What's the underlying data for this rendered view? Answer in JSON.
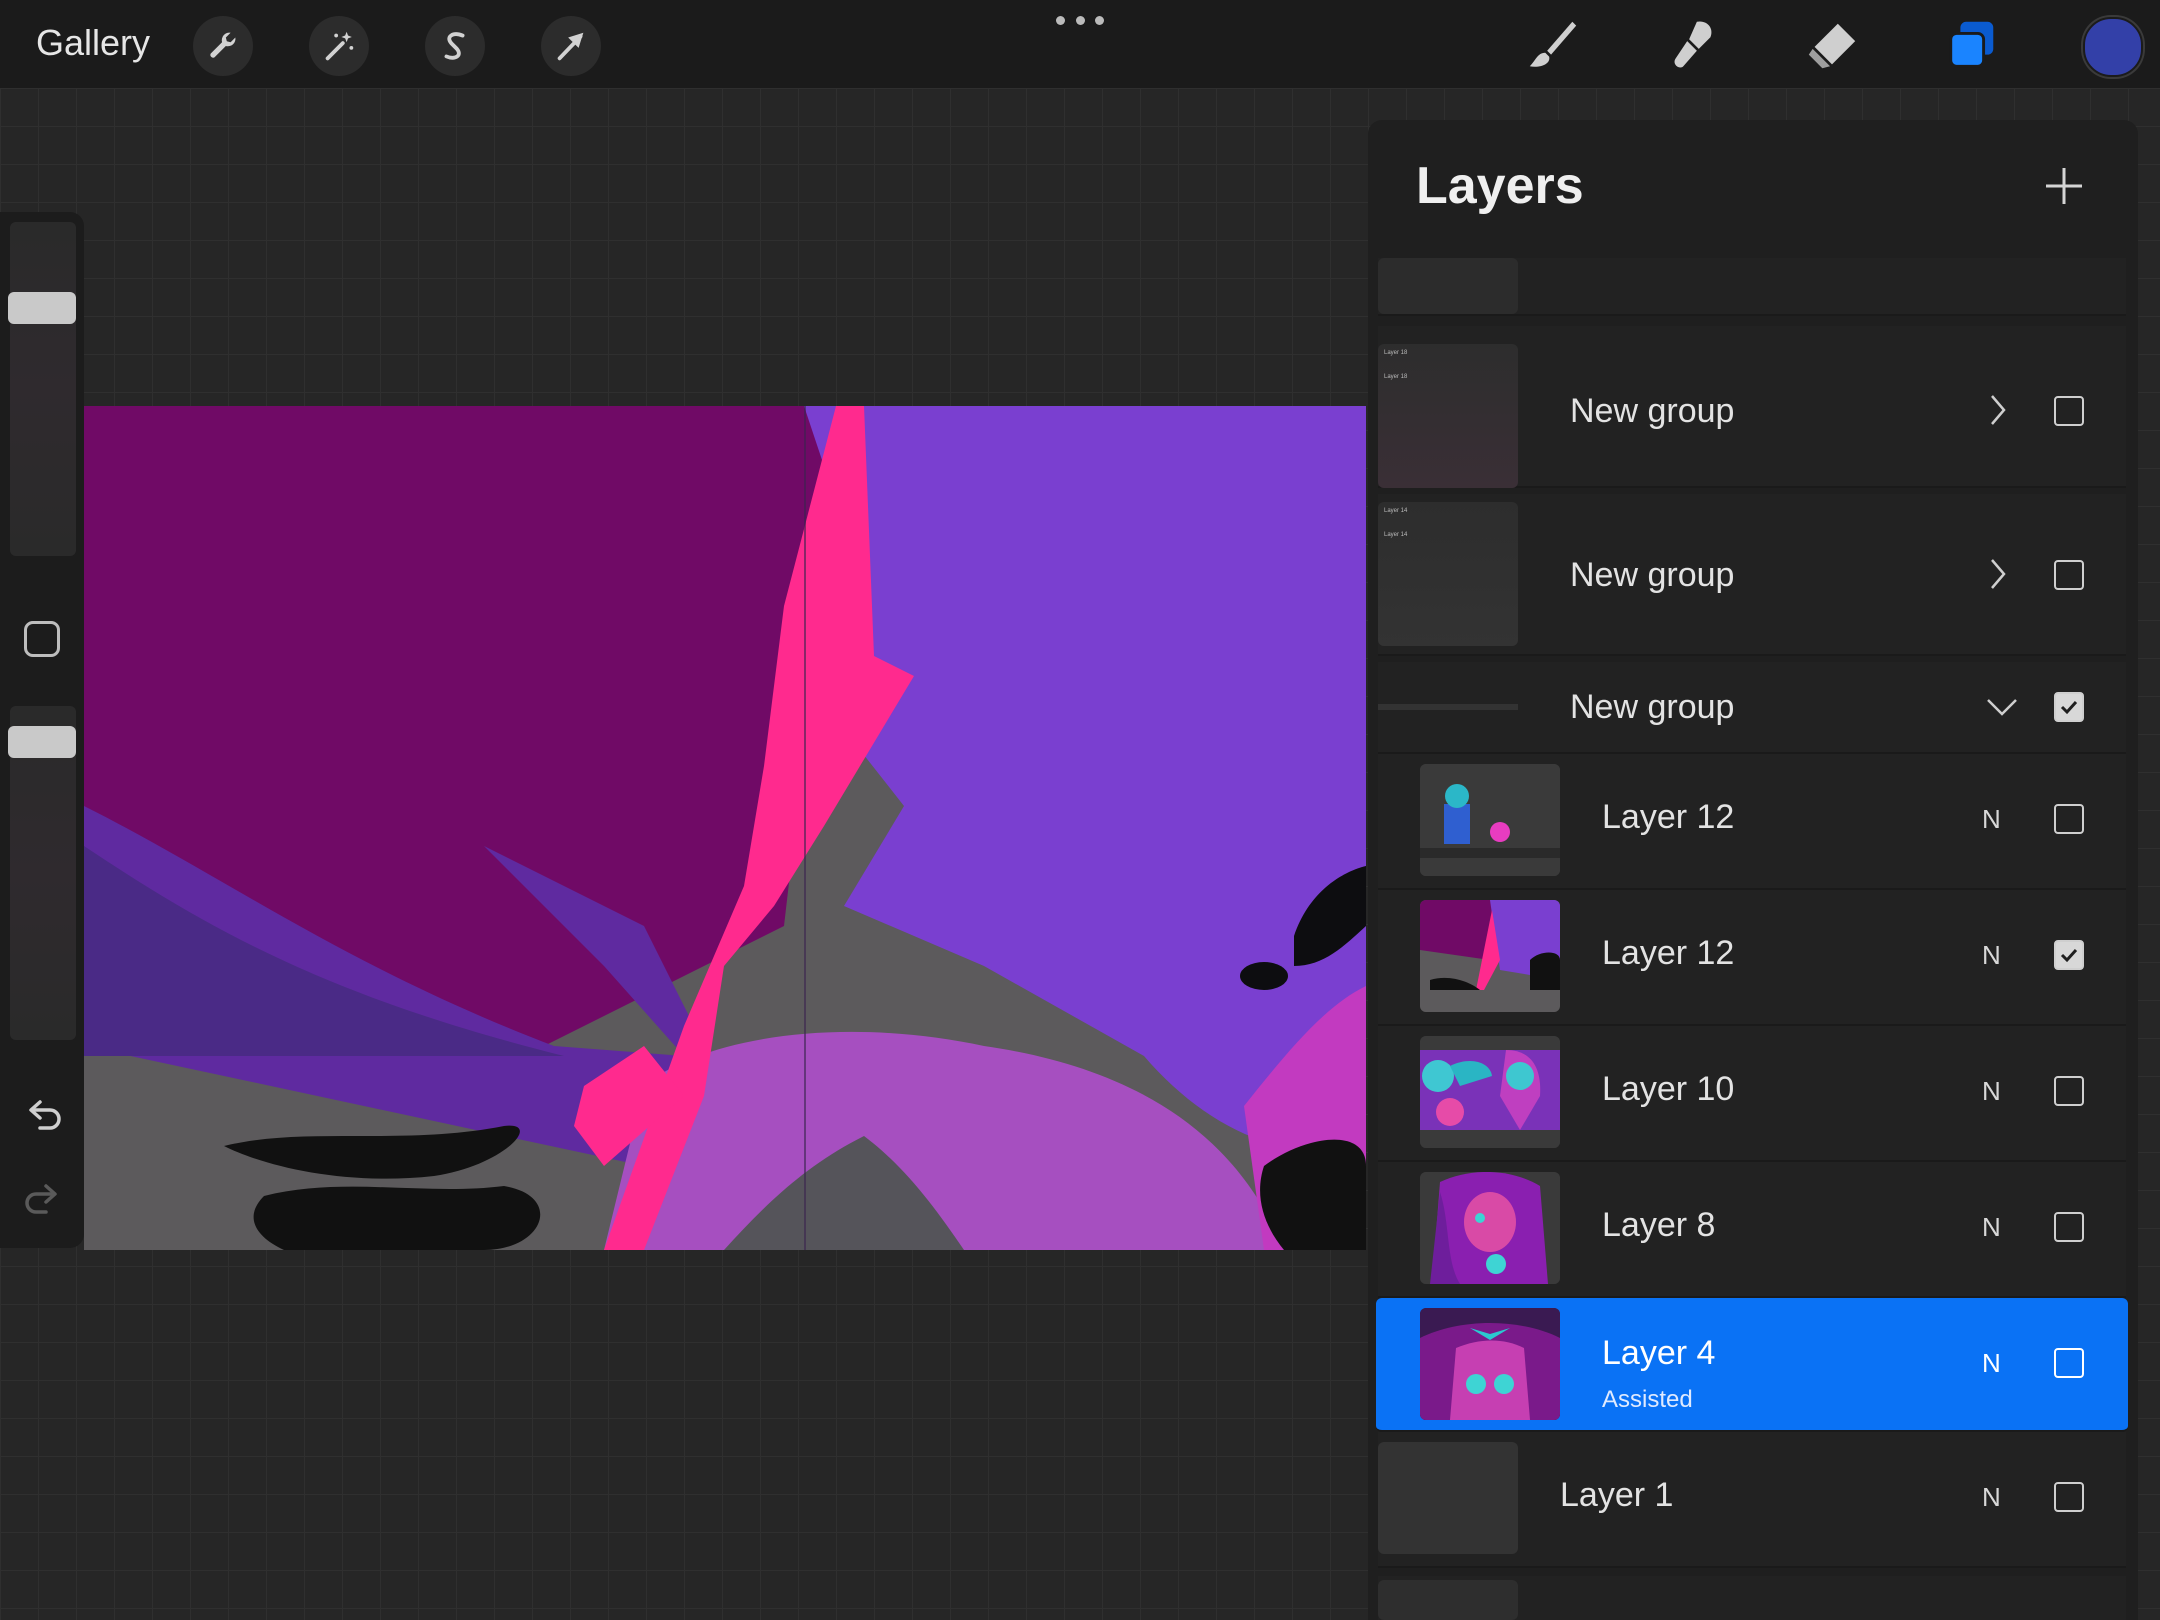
{
  "topbar": {
    "gallery_label": "Gallery",
    "tools": [
      "wrench-icon",
      "magic-wand-icon",
      "selection-s-icon",
      "transform-arrow-icon"
    ],
    "right_tools": [
      "brush-icon",
      "smudge-icon",
      "eraser-icon",
      "layers-icon"
    ],
    "current_color": "#3340a8",
    "accent": "#0a72f5"
  },
  "layers_panel": {
    "title": "Layers",
    "groups": [
      {
        "name": "New group",
        "expanded": false,
        "visible": false
      },
      {
        "name": "New group",
        "expanded": false,
        "visible": false
      },
      {
        "name": "New group",
        "expanded": true,
        "visible": true
      }
    ],
    "layers": [
      {
        "name": "Layer 12",
        "blend": "N",
        "visible": false
      },
      {
        "name": "Layer 12",
        "blend": "N",
        "visible": true
      },
      {
        "name": "Layer 10",
        "blend": "N",
        "visible": false
      },
      {
        "name": "Layer 8",
        "blend": "N",
        "visible": false
      },
      {
        "name": "Layer 4",
        "subtitle": "Assisted",
        "blend": "N",
        "visible": false,
        "selected": true
      },
      {
        "name": "Layer 1",
        "blend": "N",
        "visible": false
      }
    ],
    "mini_thumb_labels": [
      [
        "Layer 18",
        "Layer 18"
      ],
      [
        "Layer 14",
        "Layer 14"
      ]
    ]
  }
}
